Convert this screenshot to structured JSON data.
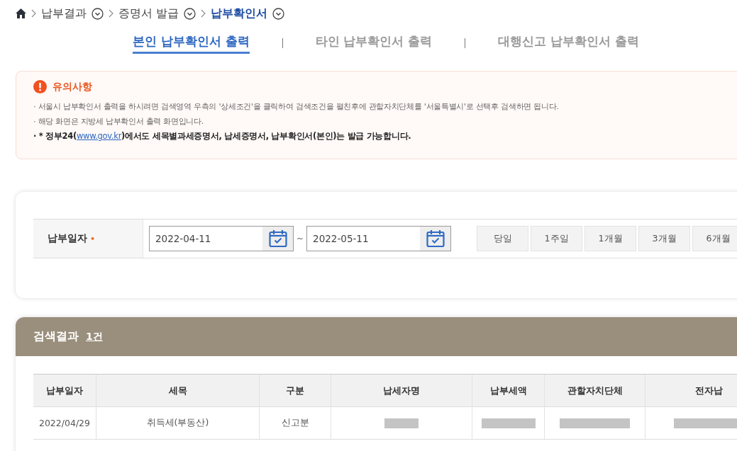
{
  "breadcrumb": [
    {
      "label": "납부결과",
      "current": false
    },
    {
      "label": "증명서 발급",
      "current": false
    },
    {
      "label": "납부확인서",
      "current": true
    }
  ],
  "tabs": [
    {
      "label": "본인 납부확인서 출력",
      "selected": true
    },
    {
      "label": "타인 납부확인서 출력",
      "selected": false
    },
    {
      "label": "대행신고 납부확인서 출력",
      "selected": false
    }
  ],
  "notice": {
    "title": "유의사항",
    "items": [
      {
        "bold": false,
        "text": "· 서울시 납부확인서 출력을 하시려면 검색영역 우측의 '상세조건'을 클릭하여 검색조건을 펼친후에 관할자치단체를 '서울특별시'로 선택후 검색하면 됩니다."
      },
      {
        "bold": false,
        "text": "· 해당 화면은 지방세 납부확인서 출력 화면입니다."
      },
      {
        "bold": true,
        "text": "· * 정부24(",
        "link": "www.gov.kr",
        "after": ")에서도 세목별과세증명서, 납세증명서, 납부확인서(본인)는 발급 가능합니다."
      }
    ]
  },
  "search": {
    "label": "납부일자",
    "required_mark": "•",
    "date_from": "2022-04-11",
    "separator": "~",
    "date_to": "2022-05-11",
    "periods": [
      "당일",
      "1주일",
      "1개월",
      "3개월",
      "6개월"
    ]
  },
  "results": {
    "title": "검색결과",
    "count": "1건",
    "table": {
      "columns": [
        "납부일자",
        "세목",
        "구분",
        "납세자명",
        "납부세액",
        "관할자치단체",
        "전자납"
      ],
      "rows": [
        [
          {
            "text": "2022/04/29",
            "redacted": false
          },
          {
            "text": "취득세(부동산)",
            "redacted": false
          },
          {
            "text": "신고분",
            "redacted": false
          },
          {
            "redacted": true
          },
          {
            "redacted": true
          },
          {
            "redacted": true
          },
          {
            "redacted": true
          }
        ]
      ]
    }
  }
}
